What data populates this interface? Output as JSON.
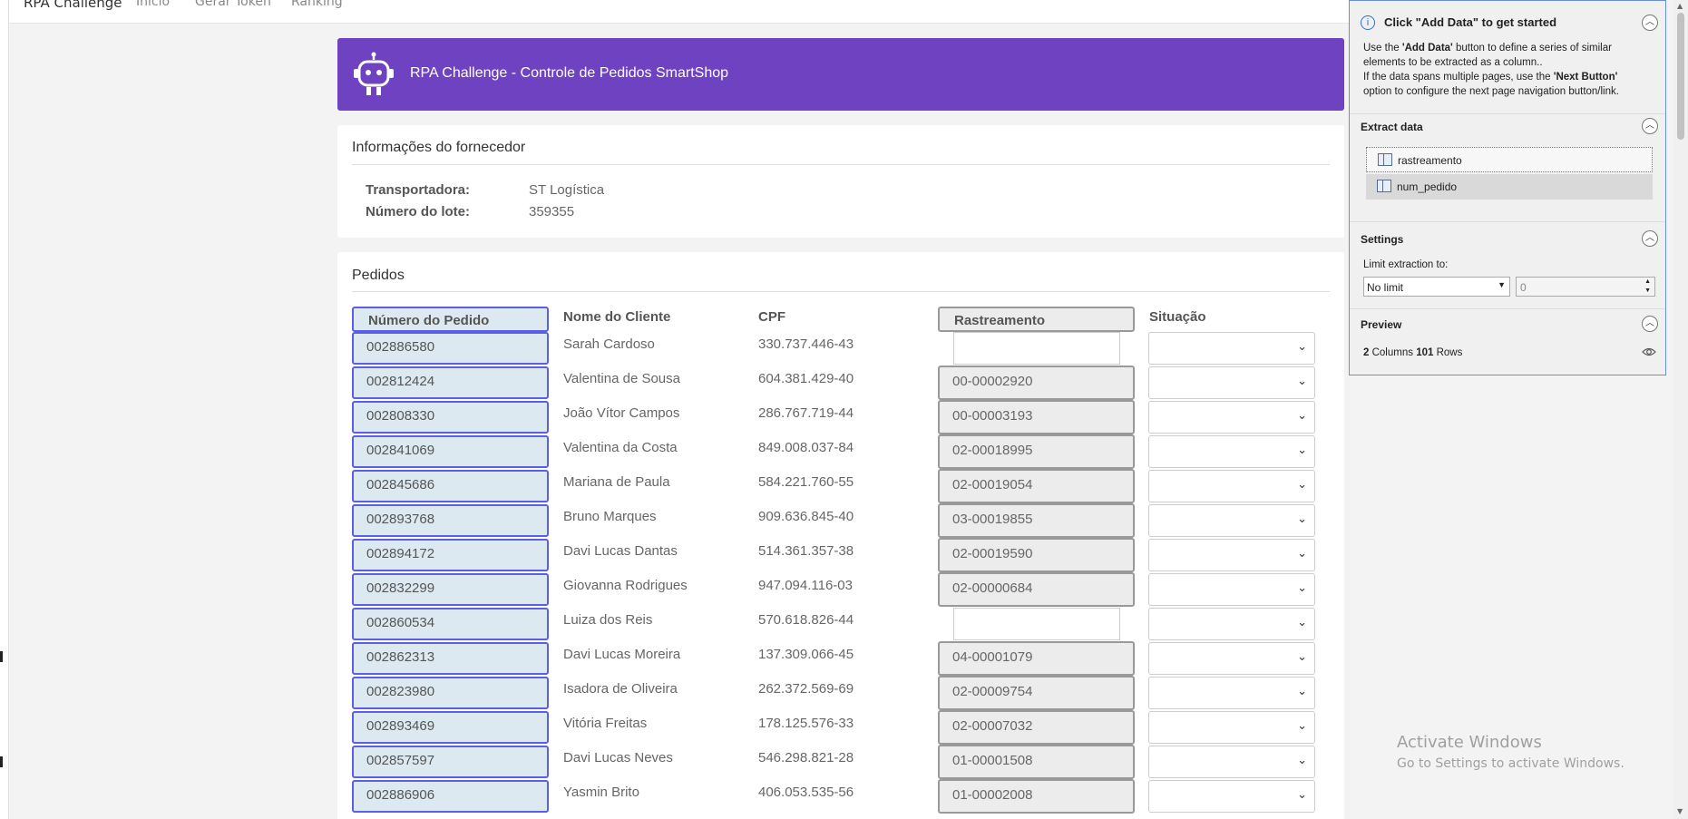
{
  "nav": {
    "brand": "RPA Challenge",
    "links": [
      "Início",
      "Gerar Token",
      "Ranking"
    ]
  },
  "banner": {
    "title": "RPA Challenge - Controle de Pedidos SmartShop",
    "color": "#6f42c1"
  },
  "supplier": {
    "title": "Informações do fornecedor",
    "carrier_label": "Transportadora:",
    "carrier_value": "ST Logística",
    "batch_label": "Número do lote:",
    "batch_value": "359355"
  },
  "orders": {
    "title": "Pedidos",
    "columns": [
      "Número do Pedido",
      "Nome do Cliente",
      "CPF",
      "Rastreamento",
      "Situação"
    ],
    "rows": [
      {
        "pedido": "002886580",
        "cliente": "Sarah Cardoso",
        "cpf": "330.737.446-43",
        "rastreamento": ""
      },
      {
        "pedido": "002812424",
        "cliente": "Valentina de Sousa",
        "cpf": "604.381.429-40",
        "rastreamento": "00-00002920"
      },
      {
        "pedido": "002808330",
        "cliente": "João Vítor Campos",
        "cpf": "286.767.719-44",
        "rastreamento": "00-00003193"
      },
      {
        "pedido": "002841069",
        "cliente": "Valentina da Costa",
        "cpf": "849.008.037-84",
        "rastreamento": "02-00018995"
      },
      {
        "pedido": "002845686",
        "cliente": "Mariana de Paula",
        "cpf": "584.221.760-55",
        "rastreamento": "02-00019054"
      },
      {
        "pedido": "002893768",
        "cliente": "Bruno Marques",
        "cpf": "909.636.845-40",
        "rastreamento": "03-00019855"
      },
      {
        "pedido": "002894172",
        "cliente": "Davi Lucas Dantas",
        "cpf": "514.361.357-38",
        "rastreamento": "02-00019590"
      },
      {
        "pedido": "002832299",
        "cliente": "Giovanna Rodrigues",
        "cpf": "947.094.116-03",
        "rastreamento": "02-00000684"
      },
      {
        "pedido": "002860534",
        "cliente": "Luiza dos Reis",
        "cpf": "570.618.826-44",
        "rastreamento": ""
      },
      {
        "pedido": "002862313",
        "cliente": "Davi Lucas Moreira",
        "cpf": "137.309.066-45",
        "rastreamento": "04-00001079"
      },
      {
        "pedido": "002823980",
        "cliente": "Isadora de Oliveira",
        "cpf": "262.372.569-69",
        "rastreamento": "02-00009754"
      },
      {
        "pedido": "002893469",
        "cliente": "Vitória Freitas",
        "cpf": "178.125.576-33",
        "rastreamento": "02-00007032"
      },
      {
        "pedido": "002857597",
        "cliente": "Davi Lucas Neves",
        "cpf": "546.298.821-28",
        "rastreamento": "01-00001508"
      },
      {
        "pedido": "002886906",
        "cliente": "Yasmin Brito",
        "cpf": "406.053.535-56",
        "rastreamento": "01-00002008"
      }
    ]
  },
  "panel": {
    "start_title": "Click \"Add Data\" to get started",
    "start_text_1a": "Use the ",
    "start_text_1b": "'Add Data'",
    "start_text_1c": " button to define a series of similar",
    "start_text_2": "elements to be extracted as a column..",
    "start_text_3a": "If the data spans multiple pages, use the ",
    "start_text_3b": "'Next Button'",
    "start_text_4": "option to configure the next page navigation button/link.",
    "extract_heading": "Extract data",
    "extract_items": [
      "rastreamento",
      "num_pedido"
    ],
    "settings_heading": "Settings",
    "limit_label": "Limit extraction to:",
    "limit_value": "No limit",
    "limit_number": "0",
    "preview_heading": "Preview",
    "preview_columns": "2",
    "preview_columns_label": "Columns",
    "preview_rows": "101",
    "preview_rows_label": "Rows"
  },
  "watermark": {
    "line1": "Activate Windows",
    "line2": "Go to Settings to activate Windows."
  }
}
